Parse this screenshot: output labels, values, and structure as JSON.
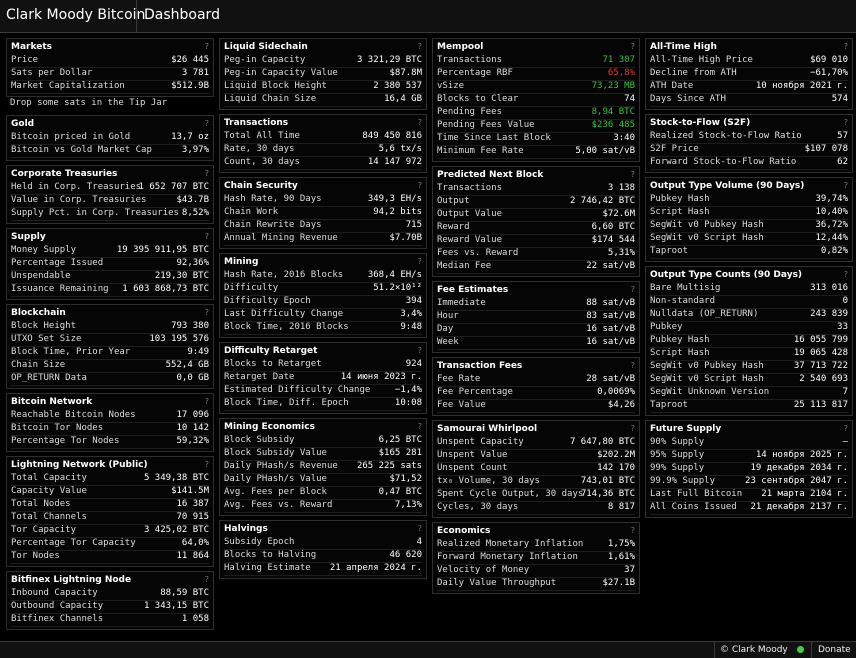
{
  "header": {
    "brand": "Clark Moody Bitcoin",
    "page_title": "Dashboard"
  },
  "help_symbol": "?",
  "footer": {
    "credit": "© Clark Moody",
    "donate": "Donate",
    "status_color": "#3fd03f"
  },
  "columns": [
    [
      {
        "title": "Markets",
        "rows": [
          [
            "Price",
            "$26 445"
          ],
          [
            "Sats per Dollar",
            "3 781"
          ],
          [
            "Market Capitalization",
            "$512.9B"
          ]
        ],
        "note": "Drop some sats in the Tip Jar"
      },
      {
        "title": "Gold",
        "rows": [
          [
            "Bitcoin priced in Gold",
            "13,7 oz"
          ],
          [
            "Bitcoin vs Gold Market Cap",
            "3,97%"
          ]
        ]
      },
      {
        "title": "Corporate Treasuries",
        "rows": [
          [
            "Held in Corp. Treasuries",
            "1 652 707 BTC"
          ],
          [
            "Value in Corp. Treasuries",
            "$43.7B"
          ],
          [
            "Supply Pct. in Corp. Treasuries",
            "8,52%"
          ]
        ]
      },
      {
        "title": "Supply",
        "rows": [
          [
            "Money Supply",
            "19 395 911,95 BTC"
          ],
          [
            "Percentage Issued",
            "92,36%"
          ],
          [
            "Unspendable",
            "219,30 BTC"
          ],
          [
            "Issuance Remaining",
            "1 603 868,73 BTC"
          ]
        ]
      },
      {
        "title": "Blockchain",
        "rows": [
          [
            "Block Height",
            "793 380"
          ],
          [
            "UTXO Set Size",
            "103 195 576"
          ],
          [
            "Block Time, Prior Year",
            "9:49"
          ],
          [
            "Chain Size",
            "552,4 GB"
          ],
          [
            "OP_RETURN Data",
            "0,0 GB"
          ]
        ]
      },
      {
        "title": "Bitcoin Network",
        "rows": [
          [
            "Reachable Bitcoin Nodes",
            "17 096"
          ],
          [
            "Bitcoin Tor Nodes",
            "10 142"
          ],
          [
            "Percentage Tor Nodes",
            "59,32%"
          ]
        ]
      },
      {
        "title": "Lightning Network (Public)",
        "rows": [
          [
            "Total Capacity",
            "5 349,38 BTC"
          ],
          [
            "Capacity Value",
            "$141.5M"
          ],
          [
            "Total Nodes",
            "16 387"
          ],
          [
            "Total Channels",
            "70 915"
          ],
          [
            "Tor Capacity",
            "3 425,02 BTC"
          ],
          [
            "Percentage Tor Capacity",
            "64,0%"
          ],
          [
            "Tor Nodes",
            "11 864"
          ]
        ]
      },
      {
        "title": "Bitfinex Lightning Node",
        "rows": [
          [
            "Inbound Capacity",
            "88,59 BTC"
          ],
          [
            "Outbound Capacity",
            "1 343,15 BTC"
          ],
          [
            "Bitfinex Channels",
            "1 058"
          ]
        ]
      }
    ],
    [
      {
        "title": "Liquid Sidechain",
        "rows": [
          [
            "Peg-in Capacity",
            "3 321,29 BTC"
          ],
          [
            "Peg-in Capacity Value",
            "$87.8M"
          ],
          [
            "Liquid Block Height",
            "2 380 537"
          ],
          [
            "Liquid Chain Size",
            "16,4 GB"
          ]
        ]
      },
      {
        "title": "Transactions",
        "rows": [
          [
            "Total All Time",
            "849 450 816"
          ],
          [
            "Rate, 30 days",
            "5,6 tx/s"
          ],
          [
            "Count, 30 days",
            "14 147 972"
          ]
        ]
      },
      {
        "title": "Chain Security",
        "rows": [
          [
            "Hash Rate, 90 Days",
            "349,3 EH/s"
          ],
          [
            "Chain Work",
            "94,2 bits"
          ],
          [
            "Chain Rewrite Days",
            "715"
          ],
          [
            "Annual Mining Revenue",
            "$7.70B"
          ]
        ]
      },
      {
        "title": "Mining",
        "rows": [
          [
            "Hash Rate, 2016 Blocks",
            "368,4 EH/s"
          ],
          [
            "Difficulty",
            "51.2×10¹²"
          ],
          [
            "Difficulty Epoch",
            "394"
          ],
          [
            "Last Difficulty Change",
            "3,4%"
          ],
          [
            "Block Time, 2016 Blocks",
            "9:48"
          ]
        ]
      },
      {
        "title": "Difficulty Retarget",
        "rows": [
          [
            "Blocks to Retarget",
            "924"
          ],
          [
            "Retarget Date",
            "14 июня 2023 г."
          ],
          [
            "Estimated Difficulty Change",
            "−1,4%"
          ],
          [
            "Block Time, Diff. Epoch",
            "10:08"
          ]
        ]
      },
      {
        "title": "Mining Economics",
        "rows": [
          [
            "Block Subsidy",
            "6,25 BTC"
          ],
          [
            "Block Subsidy Value",
            "$165 281"
          ],
          [
            "Daily PHash/s Revenue",
            "265 225 sats"
          ],
          [
            "Daily PHash/s Value",
            "$71,52"
          ],
          [
            "Avg. Fees per Block",
            "0,47 BTC"
          ],
          [
            "Avg. Fees vs. Reward",
            "7,13%"
          ]
        ]
      },
      {
        "title": "Halvings",
        "rows": [
          [
            "Subsidy Epoch",
            "4"
          ],
          [
            "Blocks to Halving",
            "46 620"
          ],
          [
            "Halving Estimate",
            "21 апреля 2024 г."
          ]
        ]
      }
    ],
    [
      {
        "title": "Mempool",
        "rows": [
          [
            "Transactions",
            "71 307",
            "green"
          ],
          [
            "Percentage RBF",
            "65,8%",
            "red"
          ],
          [
            "vSize",
            "73,23 MB",
            "green"
          ],
          [
            "Blocks to Clear",
            "74"
          ],
          [
            "Pending Fees",
            "8,94 BTC",
            "green"
          ],
          [
            "Pending Fees Value",
            "$236 485",
            "green"
          ],
          [
            "Time Since Last Block",
            "3:40"
          ],
          [
            "Minimum Fee Rate",
            "5,00 sat/vB"
          ]
        ]
      },
      {
        "title": "Predicted Next Block",
        "rows": [
          [
            "Transactions",
            "3 138"
          ],
          [
            "Output",
            "2 746,42 BTC"
          ],
          [
            "Output Value",
            "$72.6M"
          ],
          [
            "Reward",
            "6,60 BTC"
          ],
          [
            "Reward Value",
            "$174 544"
          ],
          [
            "Fees vs. Reward",
            "5,31%"
          ],
          [
            "Median Fee",
            "22 sat/vB"
          ]
        ]
      },
      {
        "title": "Fee Estimates",
        "rows": [
          [
            "Immediate",
            "88 sat/vB"
          ],
          [
            "Hour",
            "83 sat/vB"
          ],
          [
            "Day",
            "16 sat/vB"
          ],
          [
            "Week",
            "16 sat/vB"
          ]
        ]
      },
      {
        "title": "Transaction Fees",
        "rows": [
          [
            "Fee Rate",
            "28 sat/vB"
          ],
          [
            "Fee Percentage",
            "0,0069%"
          ],
          [
            "Fee Value",
            "$4,26"
          ]
        ]
      },
      {
        "title": "Samourai Whirlpool",
        "rows": [
          [
            "Unspent Capacity",
            "7 647,80 BTC"
          ],
          [
            "Unspent Value",
            "$202.2M"
          ],
          [
            "Unspent Count",
            "142 170"
          ],
          [
            "tx₀ Volume, 30 days",
            "743,01 BTC"
          ],
          [
            "Spent Cycle Output, 30 days",
            "714,36 BTC"
          ],
          [
            "Cycles, 30 days",
            "8 817"
          ]
        ]
      },
      {
        "title": "Economics",
        "rows": [
          [
            "Realized Monetary Inflation",
            "1,75%"
          ],
          [
            "Forward Monetary Inflation",
            "1,61%"
          ],
          [
            "Velocity of Money",
            "37"
          ],
          [
            "Daily Value Throughput",
            "$27.1B"
          ]
        ]
      }
    ],
    [
      {
        "title": "All-Time High",
        "rows": [
          [
            "All-Time High Price",
            "$69 010"
          ],
          [
            "Decline from ATH",
            "−61,70%"
          ],
          [
            "ATH Date",
            "10 ноября 2021 г."
          ],
          [
            "Days Since ATH",
            "574"
          ]
        ]
      },
      {
        "title": "Stock-to-Flow (S2F)",
        "rows": [
          [
            "Realized Stock-to-Flow Ratio",
            "57"
          ],
          [
            "S2F Price",
            "$107 078"
          ],
          [
            "Forward Stock-to-Flow Ratio",
            "62"
          ]
        ]
      },
      {
        "title": "Output Type Volume (90 Days)",
        "rows": [
          [
            "Pubkey Hash",
            "39,74%"
          ],
          [
            "Script Hash",
            "10,40%"
          ],
          [
            "SegWit v0 Pubkey Hash",
            "36,72%"
          ],
          [
            "SegWit v0 Script Hash",
            "12,44%"
          ],
          [
            "Taproot",
            "0,82%"
          ]
        ]
      },
      {
        "title": "Output Type Counts (90 Days)",
        "rows": [
          [
            "Bare Multisig",
            "313 016"
          ],
          [
            "Non-standard",
            "0"
          ],
          [
            "Nulldata (OP_RETURN)",
            "243 839"
          ],
          [
            "Pubkey",
            "33"
          ],
          [
            "Pubkey Hash",
            "16 055 799"
          ],
          [
            "Script Hash",
            "19 065 428"
          ],
          [
            "SegWit v0 Pubkey Hash",
            "37 713 722"
          ],
          [
            "SegWit v0 Script Hash",
            "2 540 693"
          ],
          [
            "SegWit Unknown Version",
            "7"
          ],
          [
            "Taproot",
            "25 113 817"
          ]
        ]
      },
      {
        "title": "Future Supply",
        "rows": [
          [
            "90% Supply",
            "—"
          ],
          [
            "95% Supply",
            "14 ноября 2025 г."
          ],
          [
            "99% Supply",
            "19 декабря 2034 г."
          ],
          [
            "99.9% Supply",
            "23 сентября 2047 г."
          ],
          [
            "Last Full Bitcoin",
            "21 марта 2104 г."
          ],
          [
            "All Coins Issued",
            "21 декабря 2137 г."
          ]
        ]
      }
    ]
  ]
}
